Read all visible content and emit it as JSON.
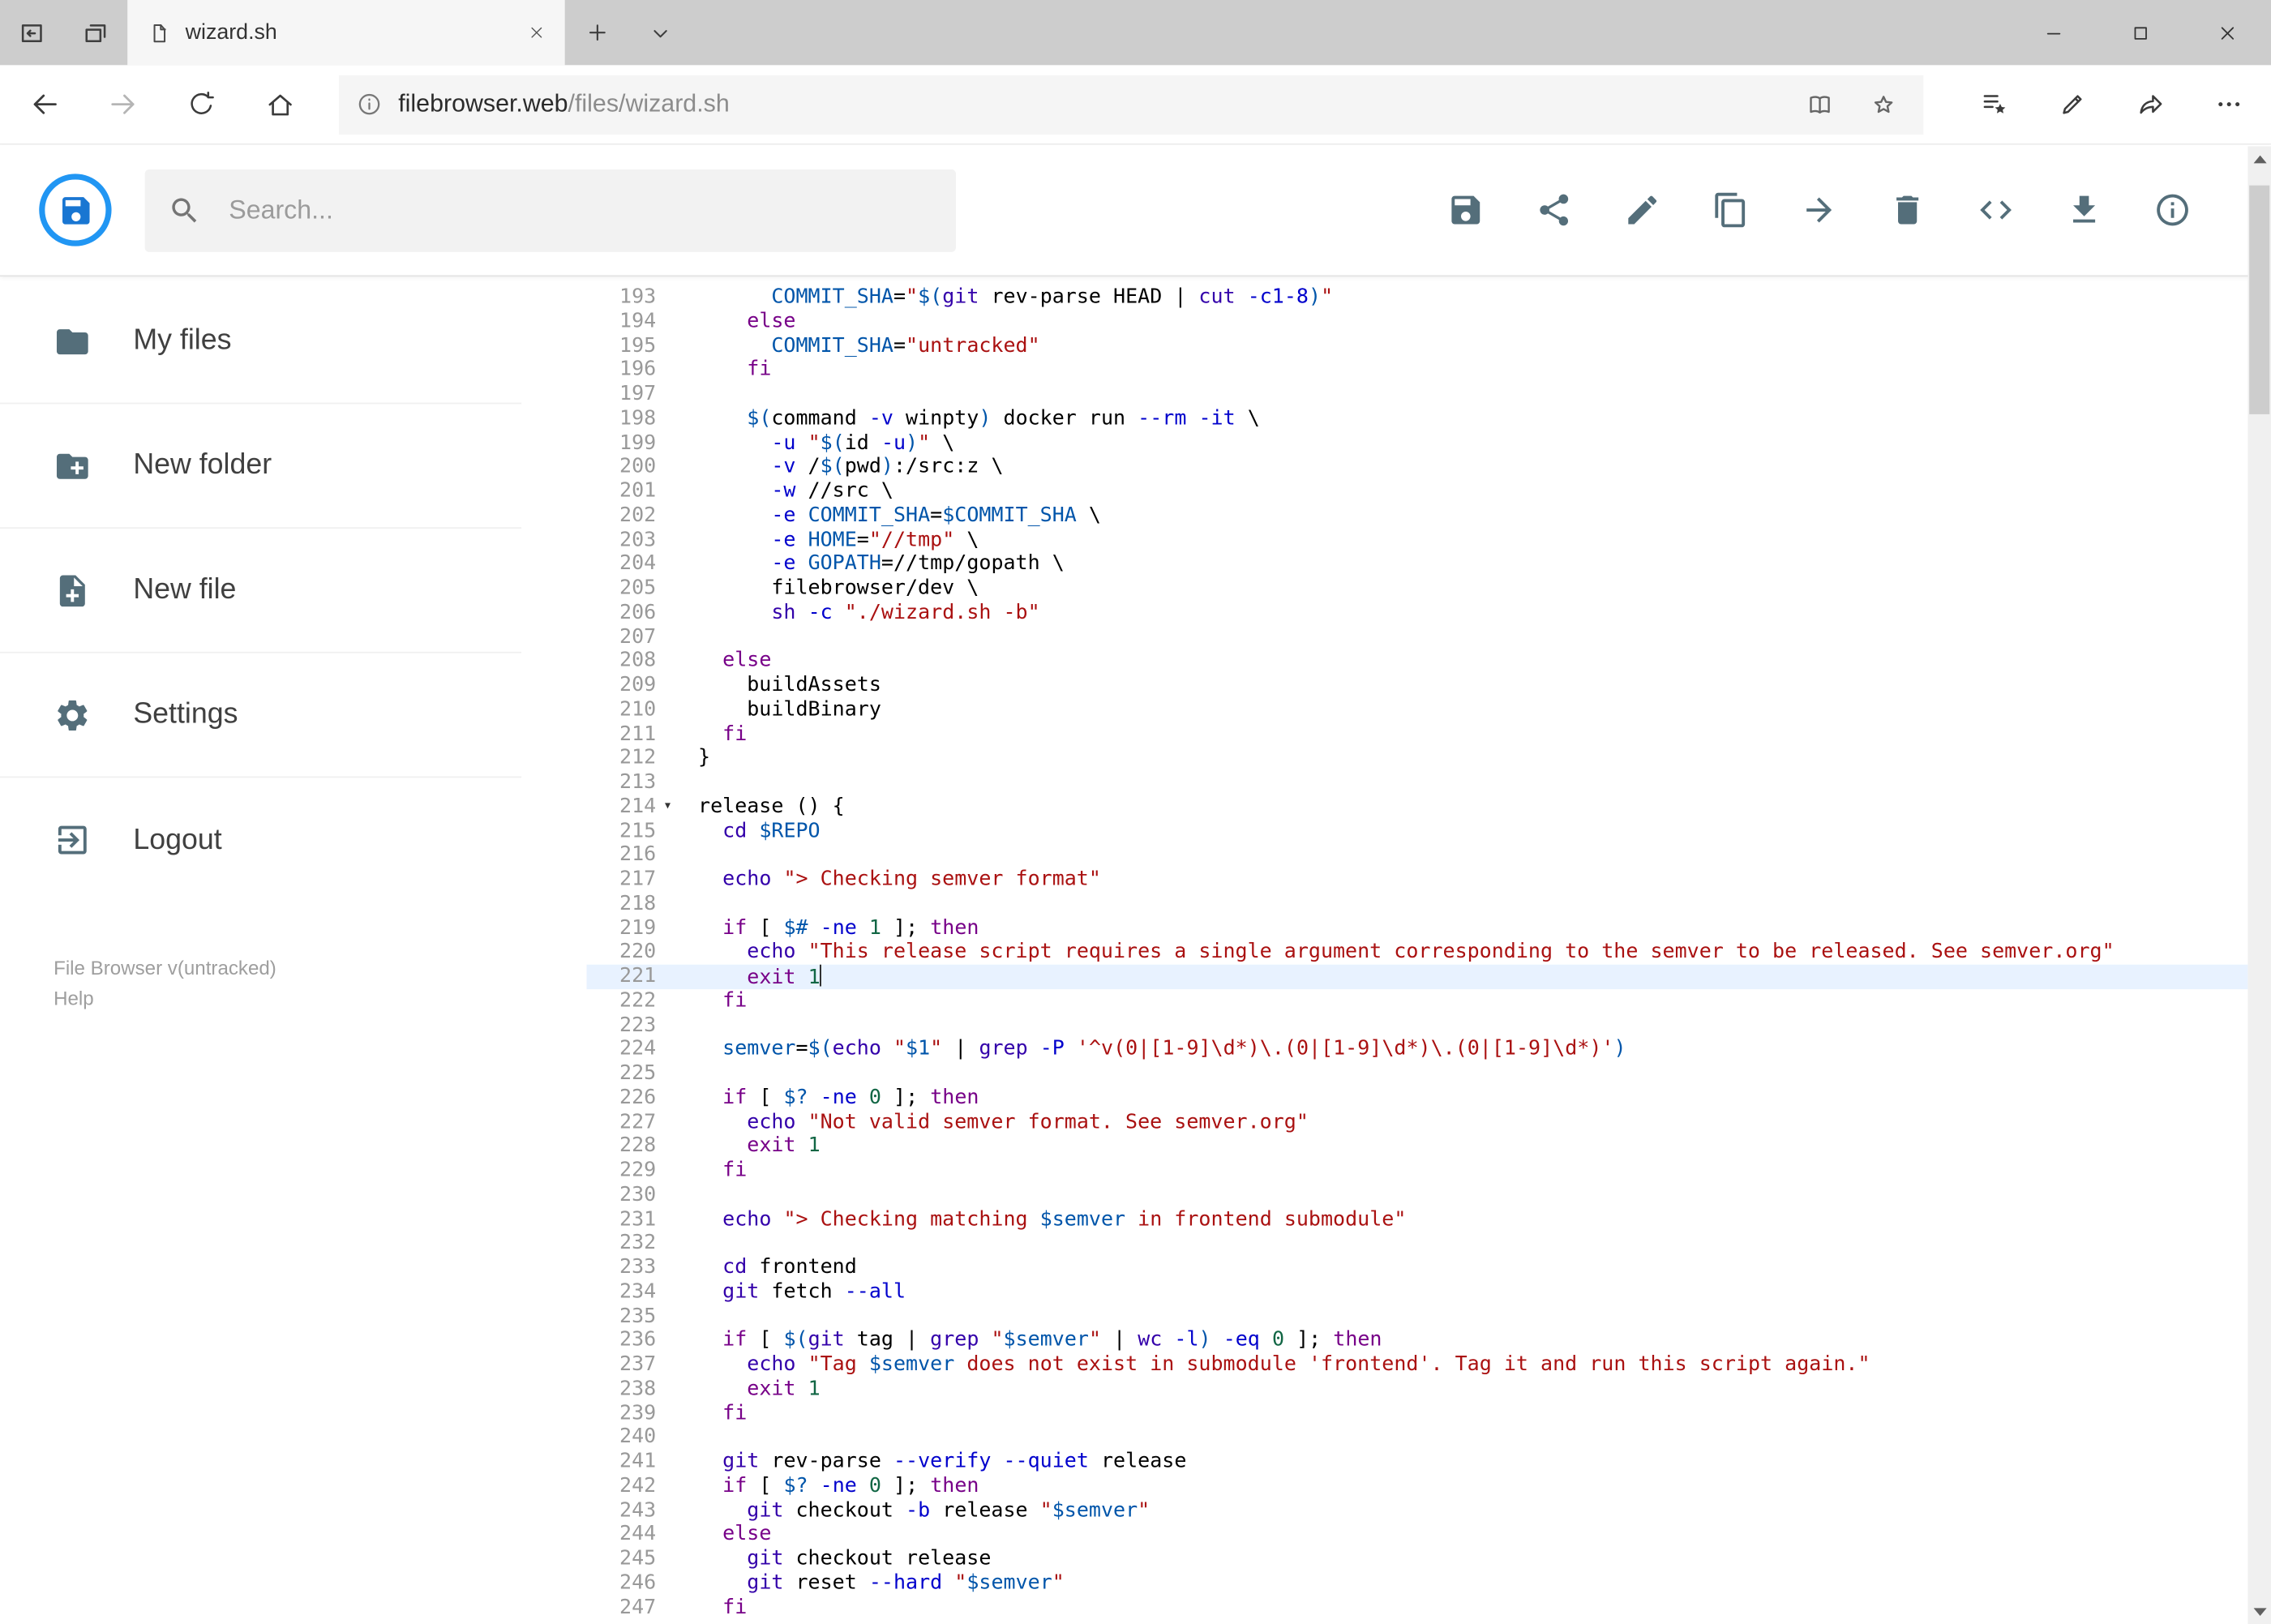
{
  "browser": {
    "tab_title": "wizard.sh",
    "url_host": "filebrowser.web",
    "url_path": "/files/wizard.sh"
  },
  "app": {
    "search_placeholder": "Search...",
    "toolbar": [
      {
        "action": "save",
        "icon": "save-icon"
      },
      {
        "action": "share",
        "icon": "share-icon"
      },
      {
        "action": "rename",
        "icon": "pencil-icon"
      },
      {
        "action": "copy",
        "icon": "copy-icon"
      },
      {
        "action": "move",
        "icon": "move-arrow-icon"
      },
      {
        "action": "delete",
        "icon": "trash-icon"
      },
      {
        "action": "switch-editor",
        "icon": "code-icon"
      },
      {
        "action": "download",
        "icon": "download-icon"
      },
      {
        "action": "info",
        "icon": "info-icon"
      }
    ],
    "sidebar": {
      "items": [
        {
          "id": "my-files",
          "icon": "folder-icon",
          "label": "My files"
        },
        {
          "id": "new-folder",
          "icon": "new-folder-icon",
          "label": "New folder"
        },
        {
          "id": "new-file",
          "icon": "new-file-icon",
          "label": "New file"
        },
        {
          "id": "settings",
          "icon": "gear-icon",
          "label": "Settings"
        },
        {
          "id": "logout",
          "icon": "logout-icon",
          "label": "Logout"
        }
      ],
      "version": "File Browser v(untracked)",
      "help": "Help"
    }
  },
  "colors": {
    "accent_blue": "#2196f3",
    "logo_blue": "#1976d2",
    "icon_slate": "#546e7a",
    "active_line_bg": "#e8f2ff"
  },
  "editor": {
    "active_line": 221,
    "cursor_line": 221,
    "fold_marker_line": 214,
    "token_colors": {
      "p": "#000000",
      "k": "#770088",
      "b": "#3300aa",
      "f": "#0000cc",
      "s": "#aa1111",
      "v": "#0055aa",
      "d": "#0055aa",
      "n": "#116644"
    },
    "lines": [
      {
        "n": 193,
        "t": [
          [
            "p",
            "      "
          ],
          [
            "d",
            "COMMIT_SHA"
          ],
          [
            "p",
            "="
          ],
          [
            "s",
            "\""
          ],
          [
            "v",
            "$("
          ],
          [
            "b",
            "git"
          ],
          [
            "p",
            " rev-parse HEAD | "
          ],
          [
            "b",
            "cut"
          ],
          [
            "p",
            " "
          ],
          [
            "f",
            "-c1-8"
          ],
          [
            "v",
            ")"
          ],
          [
            "s",
            "\""
          ]
        ]
      },
      {
        "n": 194,
        "t": [
          [
            "p",
            "    "
          ],
          [
            "k",
            "else"
          ]
        ]
      },
      {
        "n": 195,
        "t": [
          [
            "p",
            "      "
          ],
          [
            "d",
            "COMMIT_SHA"
          ],
          [
            "p",
            "="
          ],
          [
            "s",
            "\"untracked\""
          ]
        ]
      },
      {
        "n": 196,
        "t": [
          [
            "p",
            "    "
          ],
          [
            "k",
            "fi"
          ]
        ]
      },
      {
        "n": 197,
        "t": []
      },
      {
        "n": 198,
        "t": [
          [
            "p",
            "    "
          ],
          [
            "v",
            "$("
          ],
          [
            "p",
            "command "
          ],
          [
            "f",
            "-v"
          ],
          [
            "p",
            " winpty"
          ],
          [
            "v",
            ")"
          ],
          [
            "p",
            " docker run "
          ],
          [
            "f",
            "--rm"
          ],
          [
            "p",
            " "
          ],
          [
            "f",
            "-it"
          ],
          [
            "p",
            " \\"
          ]
        ]
      },
      {
        "n": 199,
        "t": [
          [
            "p",
            "      "
          ],
          [
            "f",
            "-u"
          ],
          [
            "p",
            " "
          ],
          [
            "s",
            "\""
          ],
          [
            "v",
            "$("
          ],
          [
            "p",
            "id "
          ],
          [
            "f",
            "-u"
          ],
          [
            "v",
            ")"
          ],
          [
            "s",
            "\""
          ],
          [
            "p",
            " \\"
          ]
        ]
      },
      {
        "n": 200,
        "t": [
          [
            "p",
            "      "
          ],
          [
            "f",
            "-v"
          ],
          [
            "p",
            " /"
          ],
          [
            "v",
            "$("
          ],
          [
            "p",
            "pwd"
          ],
          [
            "v",
            ")"
          ],
          [
            "p",
            ":/src:z \\"
          ]
        ]
      },
      {
        "n": 201,
        "t": [
          [
            "p",
            "      "
          ],
          [
            "f",
            "-w"
          ],
          [
            "p",
            " //src \\"
          ]
        ]
      },
      {
        "n": 202,
        "t": [
          [
            "p",
            "      "
          ],
          [
            "f",
            "-e"
          ],
          [
            "p",
            " "
          ],
          [
            "d",
            "COMMIT_SHA"
          ],
          [
            "p",
            "="
          ],
          [
            "v",
            "$COMMIT_SHA"
          ],
          [
            "p",
            " \\"
          ]
        ]
      },
      {
        "n": 203,
        "t": [
          [
            "p",
            "      "
          ],
          [
            "f",
            "-e"
          ],
          [
            "p",
            " "
          ],
          [
            "d",
            "HOME"
          ],
          [
            "p",
            "="
          ],
          [
            "s",
            "\"//tmp\""
          ],
          [
            "p",
            " \\"
          ]
        ]
      },
      {
        "n": 204,
        "t": [
          [
            "p",
            "      "
          ],
          [
            "f",
            "-e"
          ],
          [
            "p",
            " "
          ],
          [
            "d",
            "GOPATH"
          ],
          [
            "p",
            "="
          ],
          [
            "p",
            "//tmp/gopath \\"
          ]
        ]
      },
      {
        "n": 205,
        "t": [
          [
            "p",
            "      filebrowser/dev \\"
          ]
        ]
      },
      {
        "n": 206,
        "t": [
          [
            "p",
            "      "
          ],
          [
            "b",
            "sh"
          ],
          [
            "p",
            " "
          ],
          [
            "f",
            "-c"
          ],
          [
            "p",
            " "
          ],
          [
            "s",
            "\"./wizard.sh -b\""
          ]
        ]
      },
      {
        "n": 207,
        "t": []
      },
      {
        "n": 208,
        "t": [
          [
            "p",
            "  "
          ],
          [
            "k",
            "else"
          ]
        ]
      },
      {
        "n": 209,
        "t": [
          [
            "p",
            "    buildAssets"
          ]
        ]
      },
      {
        "n": 210,
        "t": [
          [
            "p",
            "    buildBinary"
          ]
        ]
      },
      {
        "n": 211,
        "t": [
          [
            "p",
            "  "
          ],
          [
            "k",
            "fi"
          ]
        ]
      },
      {
        "n": 212,
        "t": [
          [
            "p",
            "}"
          ]
        ]
      },
      {
        "n": 213,
        "t": []
      },
      {
        "n": 214,
        "t": [
          [
            "p",
            "release () {"
          ]
        ]
      },
      {
        "n": 215,
        "t": [
          [
            "p",
            "  "
          ],
          [
            "b",
            "cd"
          ],
          [
            "p",
            " "
          ],
          [
            "v",
            "$REPO"
          ]
        ]
      },
      {
        "n": 216,
        "t": []
      },
      {
        "n": 217,
        "t": [
          [
            "p",
            "  "
          ],
          [
            "b",
            "echo"
          ],
          [
            "p",
            " "
          ],
          [
            "s",
            "\"> Checking semver format\""
          ]
        ]
      },
      {
        "n": 218,
        "t": []
      },
      {
        "n": 219,
        "t": [
          [
            "p",
            "  "
          ],
          [
            "k",
            "if"
          ],
          [
            "p",
            " [ "
          ],
          [
            "v",
            "$#"
          ],
          [
            "p",
            " "
          ],
          [
            "f",
            "-ne"
          ],
          [
            "p",
            " "
          ],
          [
            "n",
            "1"
          ],
          [
            "p",
            " ]; "
          ],
          [
            "k",
            "then"
          ]
        ]
      },
      {
        "n": 220,
        "t": [
          [
            "p",
            "    "
          ],
          [
            "b",
            "echo"
          ],
          [
            "p",
            " "
          ],
          [
            "s",
            "\"This release script requires a single argument corresponding to the semver to be released. See semver.org\""
          ]
        ]
      },
      {
        "n": 221,
        "t": [
          [
            "p",
            "    "
          ],
          [
            "k",
            "exit"
          ],
          [
            "p",
            " "
          ],
          [
            "n",
            "1"
          ]
        ]
      },
      {
        "n": 222,
        "t": [
          [
            "p",
            "  "
          ],
          [
            "k",
            "fi"
          ]
        ]
      },
      {
        "n": 223,
        "t": []
      },
      {
        "n": 224,
        "t": [
          [
            "p",
            "  "
          ],
          [
            "d",
            "semver"
          ],
          [
            "p",
            "="
          ],
          [
            "v",
            "$("
          ],
          [
            "b",
            "echo"
          ],
          [
            "p",
            " "
          ],
          [
            "s",
            "\""
          ],
          [
            "v",
            "$1"
          ],
          [
            "s",
            "\""
          ],
          [
            "p",
            " | "
          ],
          [
            "b",
            "grep"
          ],
          [
            "p",
            " "
          ],
          [
            "f",
            "-P"
          ],
          [
            "p",
            " "
          ],
          [
            "s",
            "'^v(0|[1-9]\\d*)\\.(0|[1-9]\\d*)\\.(0|[1-9]\\d*)'"
          ],
          [
            "v",
            ")"
          ]
        ]
      },
      {
        "n": 225,
        "t": []
      },
      {
        "n": 226,
        "t": [
          [
            "p",
            "  "
          ],
          [
            "k",
            "if"
          ],
          [
            "p",
            " [ "
          ],
          [
            "v",
            "$?"
          ],
          [
            "p",
            " "
          ],
          [
            "f",
            "-ne"
          ],
          [
            "p",
            " "
          ],
          [
            "n",
            "0"
          ],
          [
            "p",
            " ]; "
          ],
          [
            "k",
            "then"
          ]
        ]
      },
      {
        "n": 227,
        "t": [
          [
            "p",
            "    "
          ],
          [
            "b",
            "echo"
          ],
          [
            "p",
            " "
          ],
          [
            "s",
            "\"Not valid semver format. See semver.org\""
          ]
        ]
      },
      {
        "n": 228,
        "t": [
          [
            "p",
            "    "
          ],
          [
            "k",
            "exit"
          ],
          [
            "p",
            " "
          ],
          [
            "n",
            "1"
          ]
        ]
      },
      {
        "n": 229,
        "t": [
          [
            "p",
            "  "
          ],
          [
            "k",
            "fi"
          ]
        ]
      },
      {
        "n": 230,
        "t": []
      },
      {
        "n": 231,
        "t": [
          [
            "p",
            "  "
          ],
          [
            "b",
            "echo"
          ],
          [
            "p",
            " "
          ],
          [
            "s",
            "\"> Checking matching "
          ],
          [
            "v",
            "$semver"
          ],
          [
            "s",
            " in frontend submodule\""
          ]
        ]
      },
      {
        "n": 232,
        "t": []
      },
      {
        "n": 233,
        "t": [
          [
            "p",
            "  "
          ],
          [
            "b",
            "cd"
          ],
          [
            "p",
            " frontend"
          ]
        ]
      },
      {
        "n": 234,
        "t": [
          [
            "p",
            "  "
          ],
          [
            "b",
            "git"
          ],
          [
            "p",
            " fetch "
          ],
          [
            "f",
            "--all"
          ]
        ]
      },
      {
        "n": 235,
        "t": []
      },
      {
        "n": 236,
        "t": [
          [
            "p",
            "  "
          ],
          [
            "k",
            "if"
          ],
          [
            "p",
            " [ "
          ],
          [
            "v",
            "$("
          ],
          [
            "b",
            "git"
          ],
          [
            "p",
            " tag | "
          ],
          [
            "b",
            "grep"
          ],
          [
            "p",
            " "
          ],
          [
            "s",
            "\""
          ],
          [
            "v",
            "$semver"
          ],
          [
            "s",
            "\""
          ],
          [
            "p",
            " | "
          ],
          [
            "b",
            "wc"
          ],
          [
            "p",
            " "
          ],
          [
            "f",
            "-l"
          ],
          [
            "v",
            ")"
          ],
          [
            "p",
            " "
          ],
          [
            "f",
            "-eq"
          ],
          [
            "p",
            " "
          ],
          [
            "n",
            "0"
          ],
          [
            "p",
            " ]; "
          ],
          [
            "k",
            "then"
          ]
        ]
      },
      {
        "n": 237,
        "t": [
          [
            "p",
            "    "
          ],
          [
            "b",
            "echo"
          ],
          [
            "p",
            " "
          ],
          [
            "s",
            "\"Tag "
          ],
          [
            "v",
            "$semver"
          ],
          [
            "s",
            " does not exist in submodule 'frontend'. Tag it and run this script again.\""
          ]
        ]
      },
      {
        "n": 238,
        "t": [
          [
            "p",
            "    "
          ],
          [
            "k",
            "exit"
          ],
          [
            "p",
            " "
          ],
          [
            "n",
            "1"
          ]
        ]
      },
      {
        "n": 239,
        "t": [
          [
            "p",
            "  "
          ],
          [
            "k",
            "fi"
          ]
        ]
      },
      {
        "n": 240,
        "t": []
      },
      {
        "n": 241,
        "t": [
          [
            "p",
            "  "
          ],
          [
            "b",
            "git"
          ],
          [
            "p",
            " rev-parse "
          ],
          [
            "f",
            "--verify"
          ],
          [
            "p",
            " "
          ],
          [
            "f",
            "--quiet"
          ],
          [
            "p",
            " release"
          ]
        ]
      },
      {
        "n": 242,
        "t": [
          [
            "p",
            "  "
          ],
          [
            "k",
            "if"
          ],
          [
            "p",
            " [ "
          ],
          [
            "v",
            "$?"
          ],
          [
            "p",
            " "
          ],
          [
            "f",
            "-ne"
          ],
          [
            "p",
            " "
          ],
          [
            "n",
            "0"
          ],
          [
            "p",
            " ]; "
          ],
          [
            "k",
            "then"
          ]
        ]
      },
      {
        "n": 243,
        "t": [
          [
            "p",
            "    "
          ],
          [
            "b",
            "git"
          ],
          [
            "p",
            " checkout "
          ],
          [
            "f",
            "-b"
          ],
          [
            "p",
            " release "
          ],
          [
            "s",
            "\""
          ],
          [
            "v",
            "$semver"
          ],
          [
            "s",
            "\""
          ]
        ]
      },
      {
        "n": 244,
        "t": [
          [
            "p",
            "  "
          ],
          [
            "k",
            "else"
          ]
        ]
      },
      {
        "n": 245,
        "t": [
          [
            "p",
            "    "
          ],
          [
            "b",
            "git"
          ],
          [
            "p",
            " checkout release"
          ]
        ]
      },
      {
        "n": 246,
        "t": [
          [
            "p",
            "    "
          ],
          [
            "b",
            "git"
          ],
          [
            "p",
            " reset "
          ],
          [
            "f",
            "--hard"
          ],
          [
            "p",
            " "
          ],
          [
            "s",
            "\""
          ],
          [
            "v",
            "$semver"
          ],
          [
            "s",
            "\""
          ]
        ]
      },
      {
        "n": 247,
        "t": [
          [
            "p",
            "  "
          ],
          [
            "k",
            "fi"
          ]
        ]
      }
    ]
  }
}
